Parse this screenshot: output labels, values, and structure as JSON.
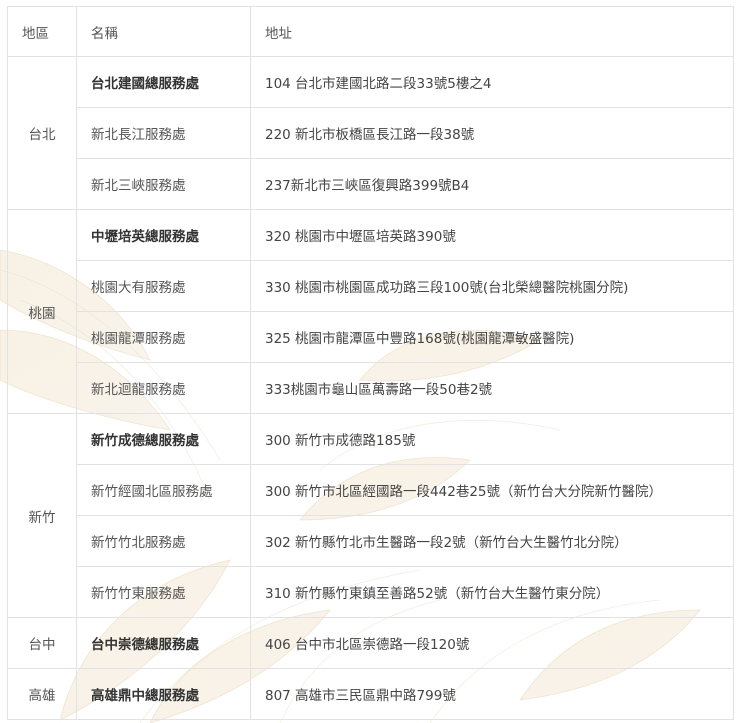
{
  "headers": {
    "region": "地區",
    "name": "名稱",
    "address": "地址"
  },
  "groups": [
    {
      "region": "台北",
      "rows": [
        {
          "name": "台北建國總服務處",
          "address": "104 台北市建國北路二段33號5樓之4",
          "bold": true
        },
        {
          "name": "新北長江服務處",
          "address": "220 新北市板橋區長江路一段38號",
          "bold": false
        },
        {
          "name": "新北三峽服務處",
          "address": "237新北市三峽區復興路399號B4",
          "bold": false
        }
      ]
    },
    {
      "region": "桃園",
      "rows": [
        {
          "name": "中壢培英總服務處",
          "address": "320 桃園市中壢區培英路390號",
          "bold": true
        },
        {
          "name": "桃園大有服務處",
          "address": "330 桃園市桃園區成功路三段100號(台北榮總醫院桃園分院)",
          "bold": false
        },
        {
          "name": "桃園龍潭服務處",
          "address": "325 桃園市龍潭區中豐路168號(桃園龍潭敏盛醫院)",
          "bold": false
        },
        {
          "name": "新北迴龍服務處",
          "address": "333桃園市龜山區萬壽路一段50巷2號",
          "bold": false
        }
      ]
    },
    {
      "region": "新竹",
      "rows": [
        {
          "name": "新竹成德總服務處",
          "address": "300 新竹市成德路185號",
          "bold": true
        },
        {
          "name": "新竹經國北區服務處",
          "address": "300 新竹市北區經國路一段442巷25號（新竹台大分院新竹醫院）",
          "bold": false
        },
        {
          "name": "新竹竹北服務處",
          "address": "302 新竹縣竹北市生醫路一段2號（新竹台大生醫竹北分院）",
          "bold": false
        },
        {
          "name": "新竹竹東服務處",
          "address": "310 新竹縣竹東鎮至善路52號（新竹台大生醫竹東分院）",
          "bold": false
        }
      ]
    },
    {
      "region": "台中",
      "rows": [
        {
          "name": "台中崇德總服務處",
          "address": "406 台中市北區崇德路一段120號",
          "bold": true
        }
      ]
    },
    {
      "region": "高雄",
      "rows": [
        {
          "name": "高雄鼎中總服務處",
          "address": "807 高雄市三民區鼎中路799號",
          "bold": true
        }
      ]
    }
  ]
}
